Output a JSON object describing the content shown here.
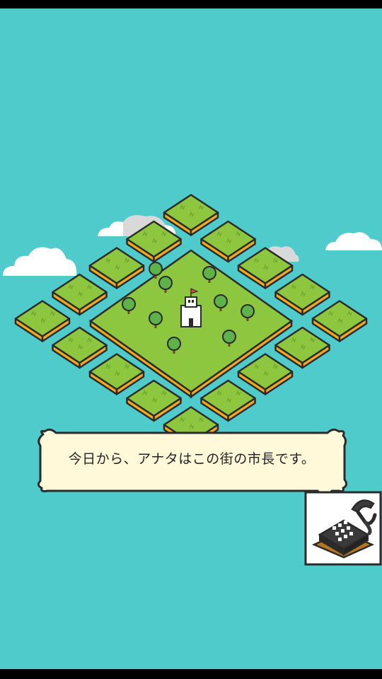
{
  "colors": {
    "sky": "#4ecbca",
    "grass": "#8dc63f",
    "tile_side": "#f2a91d",
    "outline": "#2b2b2b",
    "cloud": "#ffffff",
    "cloud_gray": "#d7d7d7",
    "tree": "#5fb14a",
    "castle": "#ffffff",
    "flag": "#e2463a",
    "dialog_bg": "#fff9d9",
    "phone": "#3a3a3a"
  },
  "map": {
    "center_plot": "town-plot",
    "building": "castle-icon",
    "tree_count": 9,
    "surrounding_tile_count": 16
  },
  "dialog": {
    "message": "今日から、アナタはこの街の市長です。"
  },
  "speaker": {
    "icon": "telephone-icon"
  }
}
